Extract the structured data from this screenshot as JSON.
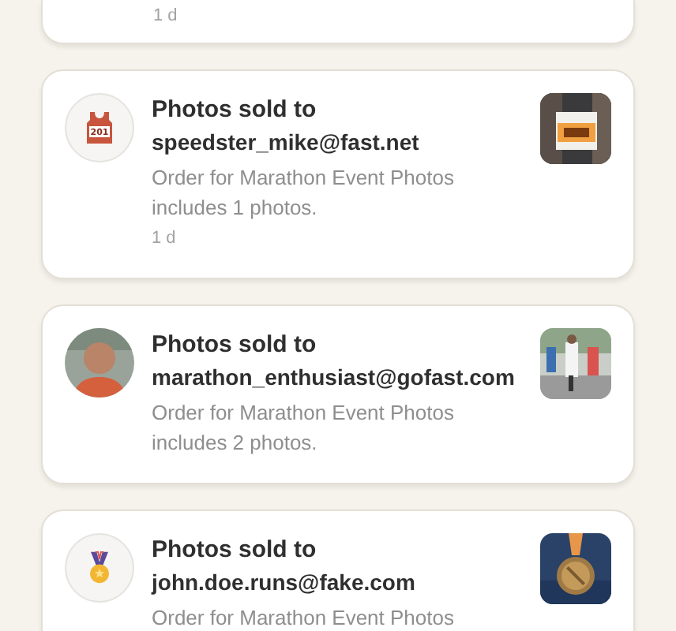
{
  "notifications": [
    {
      "time": "1 d"
    },
    {
      "avatar": {
        "kind": "bib",
        "number": "201"
      },
      "title": "Photos sold to",
      "email": "speedster_mike@fast.net",
      "description": "Order for Marathon Event Photos includes 1 photos.",
      "time": "1 d"
    },
    {
      "title": "Photos sold to",
      "email": "marathon_enthusiast@gofast.com",
      "description": "Order for Marathon Event Photos includes 2 photos."
    },
    {
      "avatar": {
        "kind": "medal"
      },
      "title": "Photos sold to",
      "email": "john.doe.runs@fake.com",
      "description": "Order for Marathon Event Photos"
    }
  ]
}
